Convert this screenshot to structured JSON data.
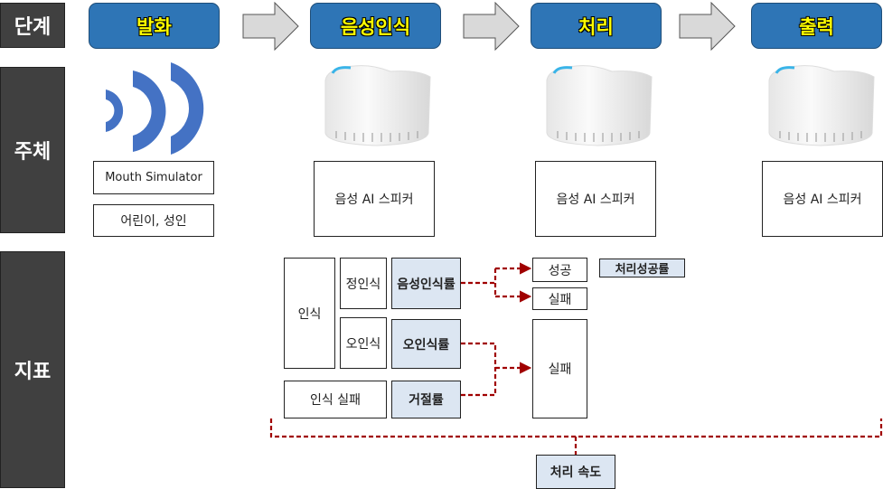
{
  "rows": {
    "stage": "단계",
    "subject": "주체",
    "metric": "지표"
  },
  "stages": [
    "발화",
    "음성인식",
    "처리",
    "출력"
  ],
  "subjects": {
    "utterance": [
      "Mouth Simulator",
      "어린이, 성인"
    ],
    "speaker": "음성 AI 스피커"
  },
  "metrics": {
    "recognition": "인식",
    "correct": "정인식",
    "correct_rate": "음성인식률",
    "misrecog": "오인식",
    "misrecog_rate": "오인식률",
    "fail_recog": "인식 실패",
    "reject_rate": "거절률",
    "success": "성공",
    "fail": "실패",
    "process_success_rate": "처리성공률",
    "fail_big": "실패",
    "speed": "처리 속도"
  },
  "colors": {
    "stage_fill": "#2e75b6",
    "stage_text": "#ffff00",
    "side": "#404040",
    "highlight": "#dce6f2",
    "connector": "#a00000"
  },
  "icons": {
    "waves": "sound-waves-icon",
    "speaker": "ai-speaker-image",
    "arrow": "right-arrow"
  }
}
